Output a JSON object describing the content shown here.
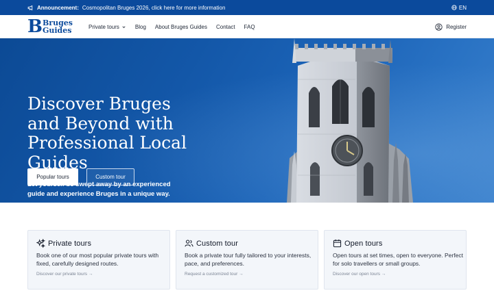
{
  "announcement": {
    "label": "Announcement:",
    "text": "Cosmopolitan Bruges 2026, click here for more information",
    "language": "EN"
  },
  "header": {
    "logo_letter": "B",
    "logo_line1": "Bruges",
    "logo_line2": "Guides",
    "nav": [
      {
        "label": "Private tours",
        "has_dropdown": true
      },
      {
        "label": "Blog"
      },
      {
        "label": "About Bruges Guides"
      },
      {
        "label": "Contact"
      },
      {
        "label": "FAQ"
      }
    ],
    "register_label": "Register"
  },
  "hero": {
    "title": "Discover Bruges and Beyond with Professional Local Guides",
    "subtitle": "Let yourself be swept away by an experienced guide and experience Bruges in a unique way.",
    "primary_button": "Popular tours",
    "secondary_button": "Custom tour"
  },
  "cards": [
    {
      "icon": "sparkles-icon",
      "title": "Private tours",
      "description": "Book one of our most popular private tours with fixed, carefully designed routes.",
      "link": "Discover our private tours →"
    },
    {
      "icon": "users-icon",
      "title": "Custom tour",
      "description": "Book a private tour fully tailored to your interests, pace, and preferences.",
      "link": "Request a customized tour →"
    },
    {
      "icon": "calendar-icon",
      "title": "Open tours",
      "description": "Open tours at set times, open to everyone. Perfect for solo travellers or small groups.",
      "link": "Discover our open tours →"
    }
  ],
  "colors": {
    "brand_blue": "#0b4a9c",
    "hero_blue": "#1357a8",
    "card_bg": "#f3f6fa"
  }
}
